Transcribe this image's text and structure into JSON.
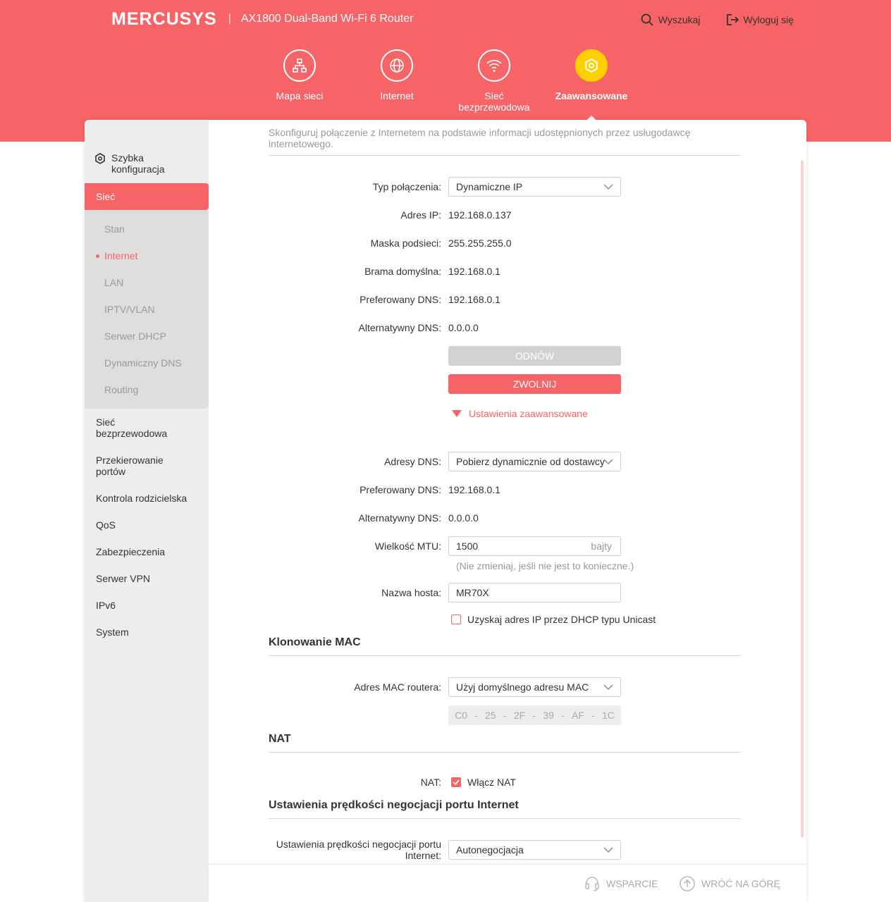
{
  "header": {
    "logo": "MERCUSYS",
    "separator": "|",
    "model": "AX1800 Dual-Band Wi-Fi 6 Router",
    "search_label": "Wyszukaj",
    "logout_label": "Wyloguj się"
  },
  "nav": {
    "items": [
      {
        "label": "Mapa sieci",
        "icon": "network-map-icon"
      },
      {
        "label": "Internet",
        "icon": "globe-icon"
      },
      {
        "label": "Sieć bezprzewodowa",
        "icon": "wifi-icon"
      },
      {
        "label": "Zaawansowane",
        "icon": "gear-icon",
        "active": true
      }
    ]
  },
  "sidebar": {
    "quick_setup": "Szybka konfiguracja",
    "active_section": "Sieć",
    "subitems": [
      {
        "label": "Stan"
      },
      {
        "label": "Internet",
        "active": true
      },
      {
        "label": "LAN"
      },
      {
        "label": "IPTV/VLAN"
      },
      {
        "label": "Serwer DHCP"
      },
      {
        "label": "Dynamiczny DNS"
      },
      {
        "label": "Routing"
      }
    ],
    "items": [
      {
        "label": "Sieć bezprzewodowa"
      },
      {
        "label": "Przekierowanie portów"
      },
      {
        "label": "Kontrola rodzicielska"
      },
      {
        "label": "QoS"
      },
      {
        "label": "Zabezpieczenia"
      },
      {
        "label": "Serwer VPN"
      },
      {
        "label": "IPv6"
      },
      {
        "label": "System"
      }
    ]
  },
  "content": {
    "intro": "Skonfiguruj połączenie z Internetem na podstawie informacji udostępnionych przez usługodawcę internetowego.",
    "connection_type_label": "Typ połączenia:",
    "connection_type_value": "Dynamiczne IP",
    "ip_label": "Adres IP:",
    "ip_value": "192.168.0.137",
    "mask_label": "Maska podsieci:",
    "mask_value": "255.255.255.0",
    "gateway_label": "Brama domyślna:",
    "gateway_value": "192.168.0.1",
    "pref_dns_label": "Preferowany DNS:",
    "pref_dns_value": "192.168.0.1",
    "alt_dns_label": "Alternatywny DNS:",
    "alt_dns_value": "0.0.0.0",
    "renew_label": "ODNÓW",
    "release_label": "ZWOLNIJ",
    "advanced_label": "Ustawienia zaawansowane",
    "dns_mode_label": "Adresy DNS:",
    "dns_mode_value": "Pobierz dynamicznie od dostawcy",
    "adv_pref_dns_label": "Preferowany DNS:",
    "adv_pref_dns_value": "192.168.0.1",
    "adv_alt_dns_label": "Alternatywny DNS:",
    "adv_alt_dns_value": "0.0.0.0",
    "mtu_label": "Wielkość MTU:",
    "mtu_value": "1500",
    "mtu_unit": "bajty",
    "mtu_hint": "(Nie zmieniaj, jeśli nie jest to konieczne.)",
    "hostname_label": "Nazwa hosta:",
    "hostname_value": "MR70X",
    "unicast_label": "Uzyskaj adres IP przez DHCP typu Unicast",
    "unicast_checked": false
  },
  "mac_section": {
    "title": "Klonowanie MAC",
    "router_mac_label": "Adres MAC routera:",
    "router_mac_value": "Użyj domyślnego adresu MAC",
    "mac_parts": [
      "C0",
      "25",
      "2F",
      "39",
      "AF",
      "1C"
    ]
  },
  "nat_section": {
    "title": "NAT",
    "nat_label": "NAT:",
    "nat_checkbox_label": "Włącz NAT",
    "nat_checked": true
  },
  "speed_section": {
    "title": "Ustawienia prędkości negocjacji portu Internet",
    "speed_label_line1": "Ustawienia prędkości negocjacji portu",
    "speed_label_line2": "Internet:",
    "speed_value": "Autonegocjacja"
  },
  "footer": {
    "support_label": "WSPARCIE",
    "top_label": "WRÓĆ NA GÓRĘ"
  },
  "colors": {
    "accent": "#f76467",
    "active_nav": "#ffd000",
    "sidebar_bg": "#ededed"
  }
}
